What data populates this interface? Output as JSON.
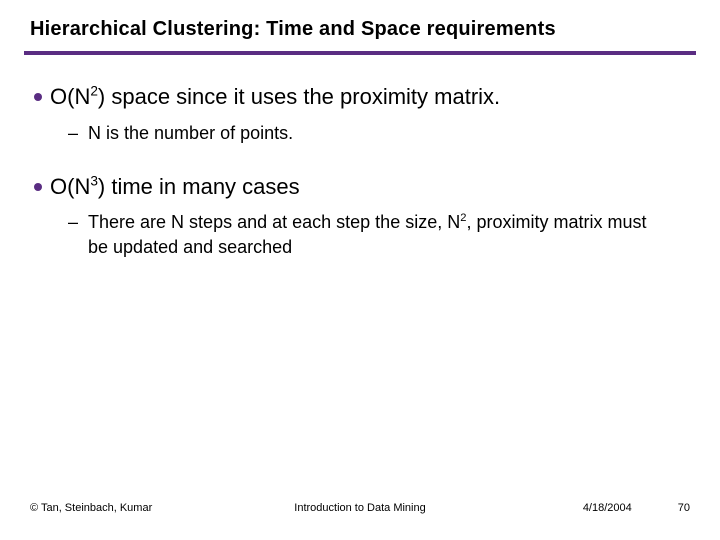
{
  "title": "Hierarchical Clustering:  Time and Space requirements",
  "bullets": [
    {
      "main_pre": "O(N",
      "main_sup": "2",
      "main_post": ") space since it uses the proximity matrix.",
      "sub_pre": "N is the number of points.",
      "sub_sup": "",
      "sub_post": ""
    },
    {
      "main_pre": "O(N",
      "main_sup": "3",
      "main_post": ") time in many cases",
      "sub_pre": "There are N steps and at each step the size, N",
      "sub_sup": "2",
      "sub_post": ", proximity matrix must be updated and searched"
    }
  ],
  "footer": {
    "left": "© Tan, Steinbach, Kumar",
    "center": "Introduction to Data Mining",
    "date": "4/18/2004",
    "page": "70"
  }
}
